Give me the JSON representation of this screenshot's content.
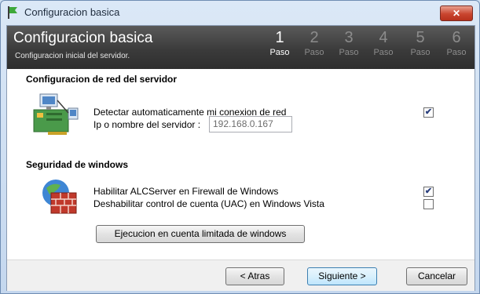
{
  "window": {
    "title": "Configuracion basica",
    "close_symbol": "✕"
  },
  "banner": {
    "title": "Configuracion basica",
    "subtitle": "Configuracion inicial del servidor.",
    "steps": [
      {
        "number": "1",
        "label": "Paso"
      },
      {
        "number": "2",
        "label": "Paso"
      },
      {
        "number": "3",
        "label": "Paso"
      },
      {
        "number": "4",
        "label": "Paso"
      },
      {
        "number": "5",
        "label": "Paso"
      },
      {
        "number": "6",
        "label": "Paso"
      }
    ],
    "active_step": "1"
  },
  "network": {
    "title": "Configuracion de red del servidor",
    "icon": "network-computers-icon",
    "detect_label": "Detectar automaticamente mi conexion de red",
    "detect_checked": true,
    "server_label": "Ip o nombre del servidor :",
    "server_value": "192.168.0.167"
  },
  "security": {
    "title": "Seguridad de windows",
    "icon": "firewall-icon",
    "firewall_label": "Habilitar ALCServer en Firewall de Windows",
    "firewall_checked": true,
    "uac_label": "Deshabilitar control de cuenta (UAC) en Windows Vista",
    "uac_checked": false,
    "limited_button": "Ejecucion en cuenta limitada de windows"
  },
  "footer": {
    "back": "< Atras",
    "next": "Siguiente >",
    "cancel": "Cancelar"
  },
  "marks": {
    "checked": "✔"
  }
}
